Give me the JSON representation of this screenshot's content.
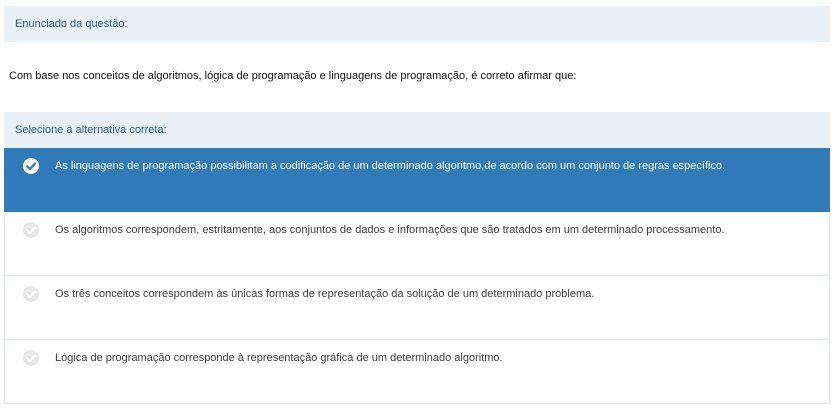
{
  "question": {
    "header": "Enunciado da questão:",
    "statement": "Com base nos conceitos de algoritmos, lógica de programação e linguagens de programação, é correto afirmar que:"
  },
  "answer": {
    "header": "Selecione a alternativa correta:",
    "options": [
      {
        "label": "As linguagens de programação possibilitam a codificação de um determinado algoritmo,de acordo com um conjunto de regras específico.",
        "selected": true
      },
      {
        "label": "Os algoritmos correspondem, estritamente, aos conjuntos de dados e informações que são tratados em um determinado processamento.",
        "selected": false
      },
      {
        "label": "Os três conceitos correspondem às únicas formas de representação da solução de um determinado problema.",
        "selected": false
      },
      {
        "label": "Lógica de programação corresponde à representação gráfica de um determinado algoritmo.",
        "selected": false
      }
    ]
  },
  "colors": {
    "header_bg": "#e9f1f7",
    "header_text": "#2a5d87",
    "selected_bg": "#2f7ab7",
    "selected_text": "#ffffff",
    "unselected_check": "#e6e6e6"
  },
  "icons": {
    "option_marker": "check-circle-icon"
  }
}
